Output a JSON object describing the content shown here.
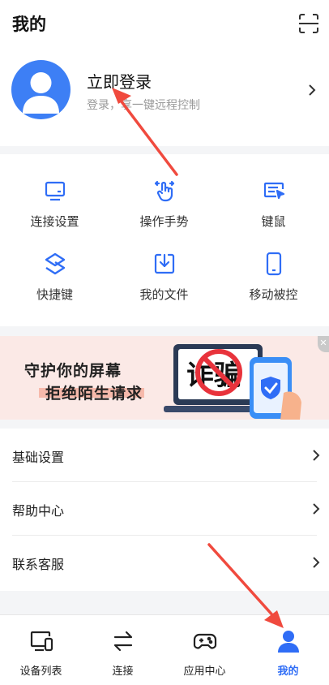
{
  "header": {
    "title": "我的"
  },
  "profile": {
    "login_title": "立即登录",
    "login_subtitle": "登录，享一键远程控制"
  },
  "tools": [
    {
      "label": "连接设置",
      "icon": "monitor-icon"
    },
    {
      "label": "操作手势",
      "icon": "touch-gesture-icon"
    },
    {
      "label": "键鼠",
      "icon": "keyboard-mouse-icon"
    },
    {
      "label": "快捷键",
      "icon": "shortcut-icon"
    },
    {
      "label": "我的文件",
      "icon": "file-download-icon"
    },
    {
      "label": "移动被控",
      "icon": "phone-icon"
    }
  ],
  "banner": {
    "line1": "守护你的屏幕",
    "line2": "拒绝陌生请求",
    "sign_text": "诈骗"
  },
  "settings": [
    {
      "label": "基础设置"
    },
    {
      "label": "帮助中心"
    },
    {
      "label": "联系客服"
    }
  ],
  "tabs": [
    {
      "label": "设备列表",
      "icon": "device-list-icon"
    },
    {
      "label": "连接",
      "icon": "connect-arrows-icon"
    },
    {
      "label": "应用中心",
      "icon": "gamepad-icon"
    },
    {
      "label": "我的",
      "icon": "person-icon",
      "active": true
    }
  ],
  "colors": {
    "accent": "#2f6df6",
    "arrow": "#f04a3e",
    "avatar_bg": "#3d7ff5"
  }
}
